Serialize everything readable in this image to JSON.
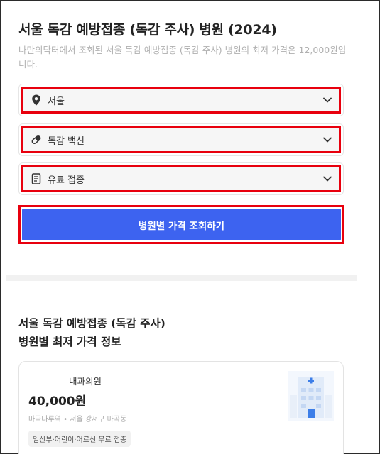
{
  "header": {
    "title": "서울 독감 예방접종 (독감 주사) 병원 (2024)",
    "description": "나만의닥터에서 조회된 서울 독감 예방접종 (독감 주사) 병원의 최저 가격은 12,000원입니다."
  },
  "filters": {
    "region": {
      "value": "서울",
      "icon": "location-pin-icon"
    },
    "vaccine": {
      "value": "독감 백신",
      "icon": "pill-capsule-icon"
    },
    "payment": {
      "value": "유료 접종",
      "icon": "document-icon"
    }
  },
  "search_button": {
    "label": "병원별 가격 조회하기"
  },
  "results": {
    "title_line1": "서울 독감 예방접종 (독감 주사)",
    "title_line2": "병원별 최저 가격 정보",
    "cards": [
      {
        "name": "내과의원",
        "price": "40,000원",
        "location": "마곡나루역 • 서울 강서구 마곡동",
        "tag": "임산부·어린이·어르신 무료 접종",
        "thumbnail": "hospital-building-icon"
      }
    ]
  },
  "colors": {
    "accent": "#3d63f0",
    "highlight_border": "#e8000e",
    "text_muted": "#b0b0b0"
  }
}
